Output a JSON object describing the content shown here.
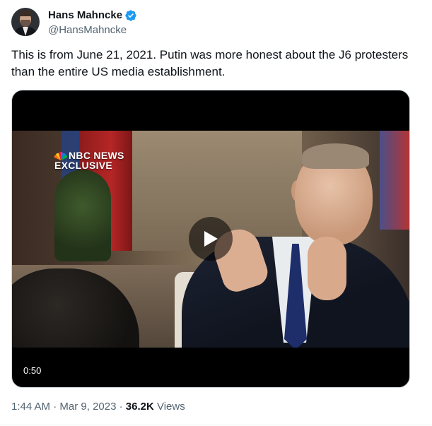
{
  "author": {
    "display_name": "Hans Mahncke",
    "handle": "@HansMahncke",
    "verified": true,
    "avatar_icon": "profile-photo"
  },
  "tweet": {
    "text": "This is from June 21, 2021. Putin was more honest about the J6 protesters than the entire US media establishment."
  },
  "media": {
    "type": "video",
    "overlay_logo_text_line1": "NBC NEWS",
    "overlay_logo_text_line2": "EXCLUSIVE",
    "duration": "0:50",
    "play_icon": "play-icon",
    "corner_logo_icon": "nbc-peacock-icon"
  },
  "meta": {
    "time": "1:44 AM",
    "separator": "·",
    "date": "Mar 9, 2023",
    "views_count": "36.2K",
    "views_label": "Views"
  },
  "colors": {
    "text_primary": "#0f1419",
    "text_secondary": "#536471",
    "verified_blue": "#1d9bf0",
    "border": "#cfd9de"
  }
}
